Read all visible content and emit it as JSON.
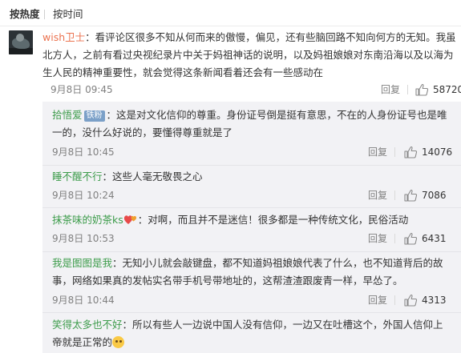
{
  "sort": {
    "hot": "按热度",
    "time": "按时间"
  },
  "main_comment": {
    "user": "wish卫士",
    "text": "：看评论区很多不知从何而来的傲慢，偏见，还有些脑回路不知向何方的无知。我虽北方人，之前有看过央视纪录片中关于妈祖神话的说明，以及妈祖娘娘对东南沿海以及以海为生人民的精神重要性，就会觉得这条新闻看着还会有一些感动在",
    "time": "9月8日 09:45",
    "reply_label": "回复",
    "likes": "58720"
  },
  "replies": [
    {
      "user": "拾悟爱",
      "badge": "铁粉",
      "text": "：这是对文化信仰的尊重。身份证号倒是挺有意思，不在的人身份证号也是唯一的，没什么好说的，要懂得尊重就是了",
      "time": "9月8日 10:45",
      "reply_label": "回复",
      "likes": "14076"
    },
    {
      "user": "睡不醒不行",
      "text": "：这些人毫无敬畏之心",
      "time": "9月8日 10:24",
      "reply_label": "回复",
      "likes": "7086"
    },
    {
      "user": "抹茶味的奶茶ks",
      "text": "：对啊，而且并不是迷信！很多都是一种传统文化，民俗活动",
      "time": "9月8日 10:53",
      "reply_label": "回复",
      "likes": "6431"
    },
    {
      "user": "我是图图是我",
      "text": "：无知小儿就会敲键盘，都不知道妈祖娘娘代表了什么，也不知道背后的故事，网络如果真的发帖实名带手机号带地址的，这帮渣渣跟废青一样，早怂了。",
      "time": "9月8日 10:44",
      "reply_label": "回复",
      "likes": "4313"
    },
    {
      "user": "笑得太多也不好",
      "text": "：所以有些人一边说中国人没有信仰，一边又在吐槽这个，外国人信仰上帝就是正常的"
    }
  ],
  "colors": {
    "username": "#eb7350",
    "reply_username": "#3d9c4b",
    "reply_bg": "#f2f2f5",
    "badge": "#7ba0c8"
  },
  "icons": {
    "like": "thumbs-up-icon",
    "hearts": "hearts-icon",
    "emoji": "grinning-face-icon"
  }
}
